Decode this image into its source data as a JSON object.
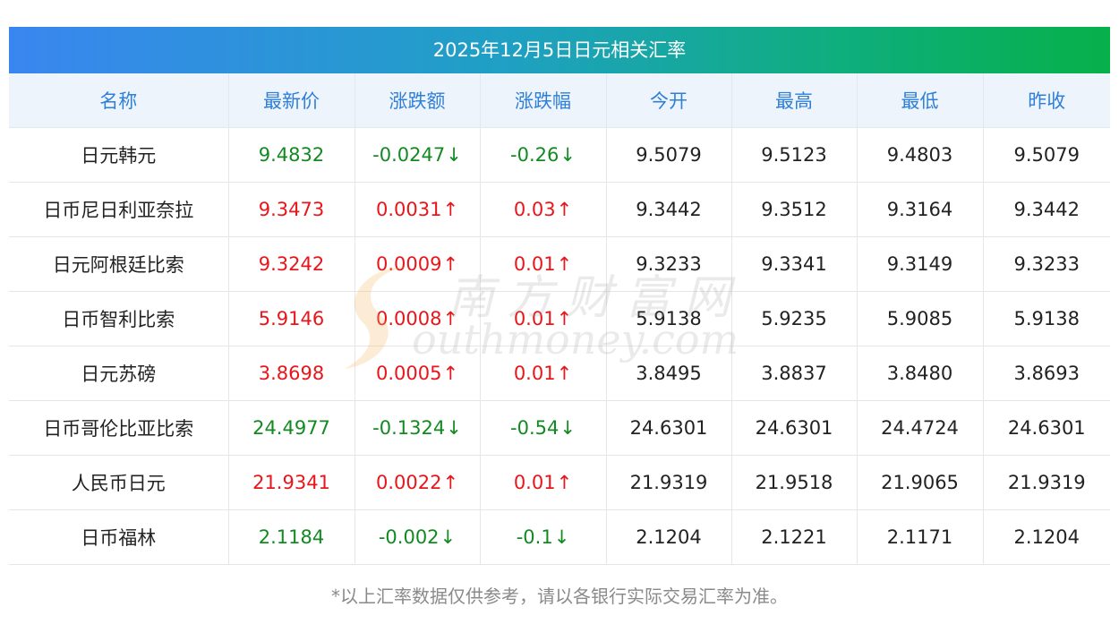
{
  "title": "2025年12月5日日元相关汇率",
  "headers": [
    "名称",
    "最新价",
    "涨跌额",
    "涨跌幅",
    "今开",
    "最高",
    "最低",
    "昨收"
  ],
  "rows": [
    {
      "name": "日元韩元",
      "latest": "9.4832",
      "change": "-0.0247",
      "pct": "-0.26",
      "dir": "down",
      "open": "9.5079",
      "high": "9.5123",
      "low": "9.4803",
      "prev": "9.5079"
    },
    {
      "name": "日币尼日利亚奈拉",
      "latest": "9.3473",
      "change": "0.0031",
      "pct": "0.03",
      "dir": "up",
      "open": "9.3442",
      "high": "9.3512",
      "low": "9.3164",
      "prev": "9.3442"
    },
    {
      "name": "日元阿根廷比索",
      "latest": "9.3242",
      "change": "0.0009",
      "pct": "0.01",
      "dir": "up",
      "open": "9.3233",
      "high": "9.3341",
      "low": "9.3149",
      "prev": "9.3233"
    },
    {
      "name": "日币智利比索",
      "latest": "5.9146",
      "change": "0.0008",
      "pct": "0.01",
      "dir": "up",
      "open": "5.9138",
      "high": "5.9235",
      "low": "5.9085",
      "prev": "5.9138"
    },
    {
      "name": "日元苏磅",
      "latest": "3.8698",
      "change": "0.0005",
      "pct": "0.01",
      "dir": "up",
      "open": "3.8495",
      "high": "3.8837",
      "low": "3.8480",
      "prev": "3.8693"
    },
    {
      "name": "日币哥伦比亚比索",
      "latest": "24.4977",
      "change": "-0.1324",
      "pct": "-0.54",
      "dir": "down",
      "open": "24.6301",
      "high": "24.6301",
      "low": "24.4724",
      "prev": "24.6301"
    },
    {
      "name": "人民币日元",
      "latest": "21.9341",
      "change": "0.0022",
      "pct": "0.01",
      "dir": "up",
      "open": "21.9319",
      "high": "21.9518",
      "low": "21.9065",
      "prev": "21.9319"
    },
    {
      "name": "日币福林",
      "latest": "2.1184",
      "change": "-0.002",
      "pct": "-0.1",
      "dir": "down",
      "open": "2.1204",
      "high": "2.1221",
      "low": "2.1171",
      "prev": "2.1204"
    }
  ],
  "arrows": {
    "up": "↑",
    "down": "↓"
  },
  "colors": {
    "up": "#e8161b",
    "down": "#138a21",
    "header_text": "#2f7fd8",
    "header_bg": "#eef4fb"
  },
  "watermark": {
    "cn": "南方财富网",
    "en": "outhmoney.com"
  },
  "footnote": "*以上汇率数据仅供参考，请以各银行实际交易汇率为准。"
}
